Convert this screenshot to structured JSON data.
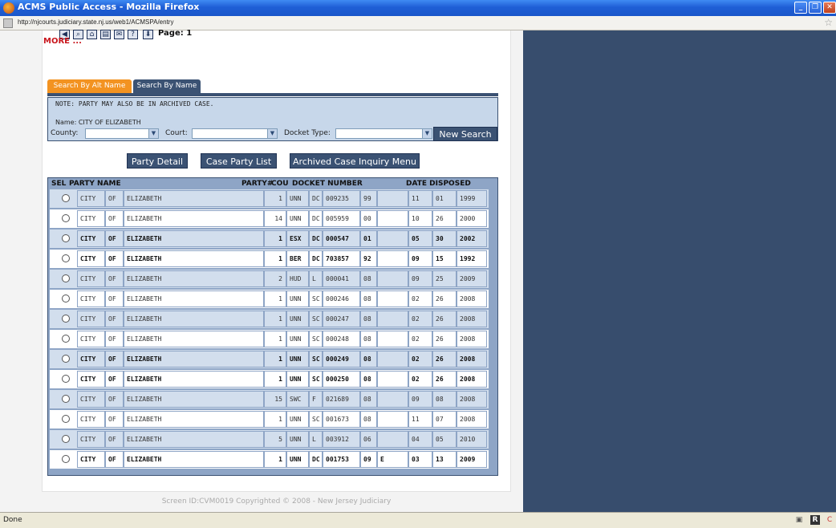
{
  "window": {
    "title": "ACMS Public Access - Mozilla Firefox",
    "url": "http://njcourts.judiciary.state.nj.us/web1/ACMSPA/entry",
    "status": "Done"
  },
  "toolbar": {
    "page_label": "Page: 1"
  },
  "more_link": "MORE ...",
  "tabs": [
    {
      "label": "Search By Alt Name",
      "active": true
    },
    {
      "label": "Search By Name",
      "active": false
    }
  ],
  "search": {
    "note": "NOTE: PARTY MAY ALSO BE IN ARCHIVED CASE.",
    "name_line": "Name: CITY OF ELIZABETH",
    "county_label": "County:",
    "county_value": "",
    "court_label": "Court:",
    "court_value": "",
    "docket_type_label": "Docket Type:",
    "docket_type_value": "",
    "new_search_label": "New Search"
  },
  "actions": {
    "party_detail": "Party Detail",
    "case_party_list": "Case Party List",
    "archived_case_inquiry": "Archived Case Inquiry Menu"
  },
  "table": {
    "headers": {
      "sel": "SEL",
      "party_name": "PARTY NAME",
      "party_num": "PARTY#",
      "cou": "COU",
      "docket_number": "DOCKET NUMBER",
      "date_disposed": "DATE DISPOSED"
    },
    "rows": [
      {
        "n1": "CITY",
        "n2": "OF",
        "n3": "ELIZABETH",
        "party": "1",
        "county": "UNN",
        "type": "DC",
        "docket": "009235",
        "year": "99",
        "extra": "",
        "month": "11",
        "day": "01",
        "dyear": "1999",
        "bold": false
      },
      {
        "n1": "CITY",
        "n2": "OF",
        "n3": "ELIZABETH",
        "party": "14",
        "county": "UNN",
        "type": "DC",
        "docket": "005959",
        "year": "00",
        "extra": "",
        "month": "10",
        "day": "26",
        "dyear": "2000",
        "bold": false
      },
      {
        "n1": "CITY",
        "n2": "OF",
        "n3": "ELIZABETH",
        "party": "1",
        "county": "ESX",
        "type": "DC",
        "docket": "000547",
        "year": "01",
        "extra": "",
        "month": "05",
        "day": "30",
        "dyear": "2002",
        "bold": true
      },
      {
        "n1": "CITY",
        "n2": "OF",
        "n3": "ELIZABETH",
        "party": "1",
        "county": "BER",
        "type": "DC",
        "docket": "703857",
        "year": "92",
        "extra": "",
        "month": "09",
        "day": "15",
        "dyear": "1992",
        "bold": true
      },
      {
        "n1": "CITY",
        "n2": "OF",
        "n3": "ELIZABETH",
        "party": "2",
        "county": "HUD",
        "type": "L",
        "docket": "000041",
        "year": "08",
        "extra": "",
        "month": "09",
        "day": "25",
        "dyear": "2009",
        "bold": false
      },
      {
        "n1": "CITY",
        "n2": "OF",
        "n3": "ELIZABETH",
        "party": "1",
        "county": "UNN",
        "type": "SC",
        "docket": "000246",
        "year": "08",
        "extra": "",
        "month": "02",
        "day": "26",
        "dyear": "2008",
        "bold": false
      },
      {
        "n1": "CITY",
        "n2": "OF",
        "n3": "ELIZABETH",
        "party": "1",
        "county": "UNN",
        "type": "SC",
        "docket": "000247",
        "year": "08",
        "extra": "",
        "month": "02",
        "day": "26",
        "dyear": "2008",
        "bold": false
      },
      {
        "n1": "CITY",
        "n2": "OF",
        "n3": "ELIZABETH",
        "party": "1",
        "county": "UNN",
        "type": "SC",
        "docket": "000248",
        "year": "08",
        "extra": "",
        "month": "02",
        "day": "26",
        "dyear": "2008",
        "bold": false
      },
      {
        "n1": "CITY",
        "n2": "OF",
        "n3": "ELIZABETH",
        "party": "1",
        "county": "UNN",
        "type": "SC",
        "docket": "000249",
        "year": "08",
        "extra": "",
        "month": "02",
        "day": "26",
        "dyear": "2008",
        "bold": true
      },
      {
        "n1": "CITY",
        "n2": "OF",
        "n3": "ELIZABETH",
        "party": "1",
        "county": "UNN",
        "type": "SC",
        "docket": "000250",
        "year": "08",
        "extra": "",
        "month": "02",
        "day": "26",
        "dyear": "2008",
        "bold": true
      },
      {
        "n1": "CITY",
        "n2": "OF",
        "n3": "ELIZABETH",
        "party": "15",
        "county": "SWC",
        "type": "F",
        "docket": "021689",
        "year": "08",
        "extra": "",
        "month": "09",
        "day": "08",
        "dyear": "2008",
        "bold": false
      },
      {
        "n1": "CITY",
        "n2": "OF",
        "n3": "ELIZABETH",
        "party": "1",
        "county": "UNN",
        "type": "SC",
        "docket": "001673",
        "year": "08",
        "extra": "",
        "month": "11",
        "day": "07",
        "dyear": "2008",
        "bold": false
      },
      {
        "n1": "CITY",
        "n2": "OF",
        "n3": "ELIZABETH",
        "party": "5",
        "county": "UNN",
        "type": "L",
        "docket": "003912",
        "year": "06",
        "extra": "",
        "month": "04",
        "day": "05",
        "dyear": "2010",
        "bold": false
      },
      {
        "n1": "CITY",
        "n2": "OF",
        "n3": "ELIZABETH",
        "party": "1",
        "county": "UNN",
        "type": "DC",
        "docket": "001753",
        "year": "09",
        "extra": "E",
        "month": "03",
        "day": "13",
        "dyear": "2009",
        "bold": true
      }
    ]
  },
  "footer": "Screen ID:CVM0019 Copyrighted © 2008 - New Jersey Judiciary"
}
